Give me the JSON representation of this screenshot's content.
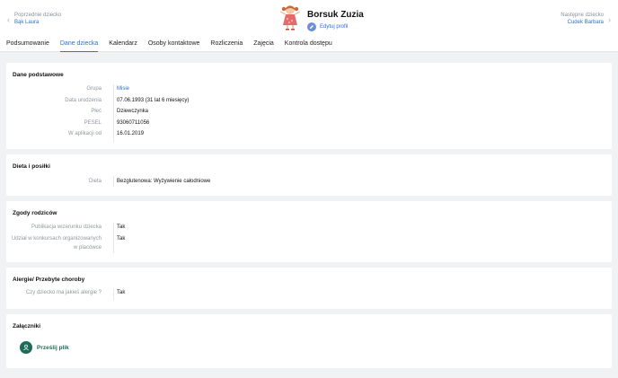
{
  "header": {
    "prev_label": "Poprzednie dziecko",
    "prev_name": "Bąk Laura",
    "next_label": "Następne dziecko",
    "next_name": "Cudek Barbara",
    "child_name": "Borsuk Zuzia",
    "edit_profile": "Edytuj profil"
  },
  "tabs": [
    {
      "label": "Podsumowanie"
    },
    {
      "label": "Dane dziecka"
    },
    {
      "label": "Kalendarz"
    },
    {
      "label": "Osoby kontaktowe"
    },
    {
      "label": "Rozliczenia"
    },
    {
      "label": "Zajęcia"
    },
    {
      "label": "Kontrola dostępu"
    }
  ],
  "active_tab": "Dane dziecka",
  "basic": {
    "title": "Dane podstawowe",
    "rows": [
      {
        "label": "Grupa",
        "value": "Misie"
      },
      {
        "label": "Data urodzenia",
        "value": "07.06.1993 (31 lat 6 miesięcy)"
      },
      {
        "label": "Płeć",
        "value": "Dziewczynka"
      },
      {
        "label": "PESEL",
        "value": "93060711056"
      },
      {
        "label": "W aplikacji od",
        "value": "16.01.2019"
      }
    ]
  },
  "diet": {
    "title": "Dieta i posiłki",
    "rows": [
      {
        "label": "Dieta",
        "value": "Bezglutenowa: Wyżywienie całodniowe"
      }
    ]
  },
  "consents": {
    "title": "Zgody rodziców",
    "rows": [
      {
        "label": "Publikacja wizerunku dziecka",
        "value": "Tak"
      },
      {
        "label_line1": "Udział w konkursach organizowanych",
        "label_line2": "w placówce",
        "value": "Tak"
      }
    ]
  },
  "allergies": {
    "title": "Alergie/ Przebyte choroby",
    "rows": [
      {
        "label": "Czy dziecko ma jakieś alergie ?",
        "value": "Tak"
      }
    ]
  },
  "attachments": {
    "title": "Załączniki",
    "upload_label": "Prześlij plik"
  },
  "colors": {
    "accent": "#2f6fd6",
    "upload": "#1f6b5a",
    "background": "#f1f2f4"
  }
}
